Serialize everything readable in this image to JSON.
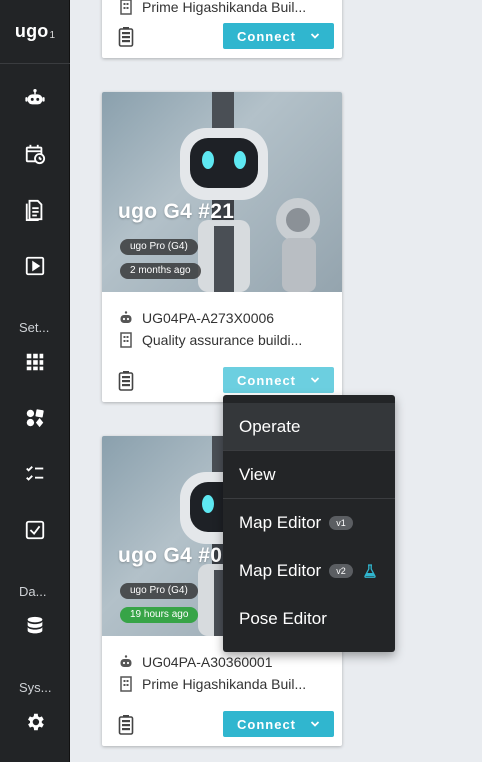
{
  "app": {
    "logo": "ugo",
    "logo_sub": "1"
  },
  "sidebar": {
    "sections": [
      {
        "label": "Set..."
      },
      {
        "label": "Da..."
      },
      {
        "label": "Sys..."
      }
    ],
    "items": [
      {
        "name": "robots",
        "icon": "robot-icon"
      },
      {
        "name": "schedule",
        "icon": "calendar-clock-icon"
      },
      {
        "name": "reports",
        "icon": "document-icon"
      },
      {
        "name": "playback",
        "icon": "play-box-icon"
      },
      {
        "name": "apps",
        "icon": "grid-icon"
      },
      {
        "name": "shapes",
        "icon": "shapes-icon"
      },
      {
        "name": "checklist",
        "icon": "checklist-icon"
      },
      {
        "name": "tasks",
        "icon": "check-box-icon"
      },
      {
        "name": "database",
        "icon": "database-icon"
      },
      {
        "name": "settings",
        "icon": "gear-icon"
      }
    ]
  },
  "cards": [
    {
      "building": "Prime Higashikanda Buil...",
      "connect_label": "Connect"
    },
    {
      "title": "ugo G4 #21",
      "model": "ugo Pro (G4)",
      "last_seen": "2 months ago",
      "serial": "UG04PA-A273X0006",
      "building": "Quality assurance buildi...",
      "connect_label": "Connect"
    },
    {
      "title": "ugo G4 #0",
      "model": "ugo Pro (G4)",
      "last_seen": "19 hours ago",
      "serial": "UG04PA-A30360001",
      "building": "Prime Higashikanda Buil...",
      "connect_label": "Connect"
    }
  ],
  "dropdown": {
    "items": [
      {
        "label": "Operate"
      },
      {
        "label": "View"
      },
      {
        "label": "Map Editor",
        "badge": "v1"
      },
      {
        "label": "Map Editor",
        "badge": "v2",
        "icon": "flask-icon"
      },
      {
        "label": "Pose Editor"
      }
    ]
  },
  "colors": {
    "accent": "#30b6cf",
    "accent_active": "#6ccfe0",
    "sidebar_bg": "#222426",
    "online_green": "#37a447"
  }
}
